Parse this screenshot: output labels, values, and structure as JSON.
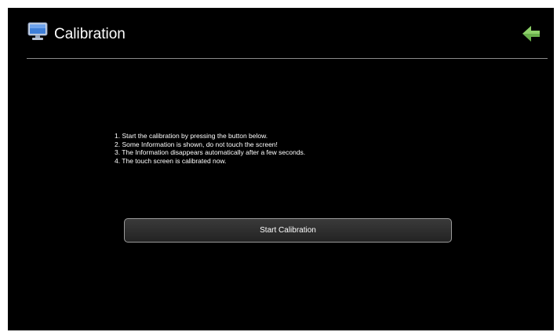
{
  "header": {
    "title": "Calibration",
    "icon": "monitor-icon",
    "back_icon": "back-arrow-icon",
    "accent_color": "#6ab04c"
  },
  "instructions": [
    "1. Start the calibration by pressing the button below.",
    "2. Some Information is shown, do not touch the screen!",
    "3. The Information disappears automatically after a few seconds.",
    "4. The touch screen is calibrated now."
  ],
  "start_button": {
    "label": "Start Calibration"
  }
}
